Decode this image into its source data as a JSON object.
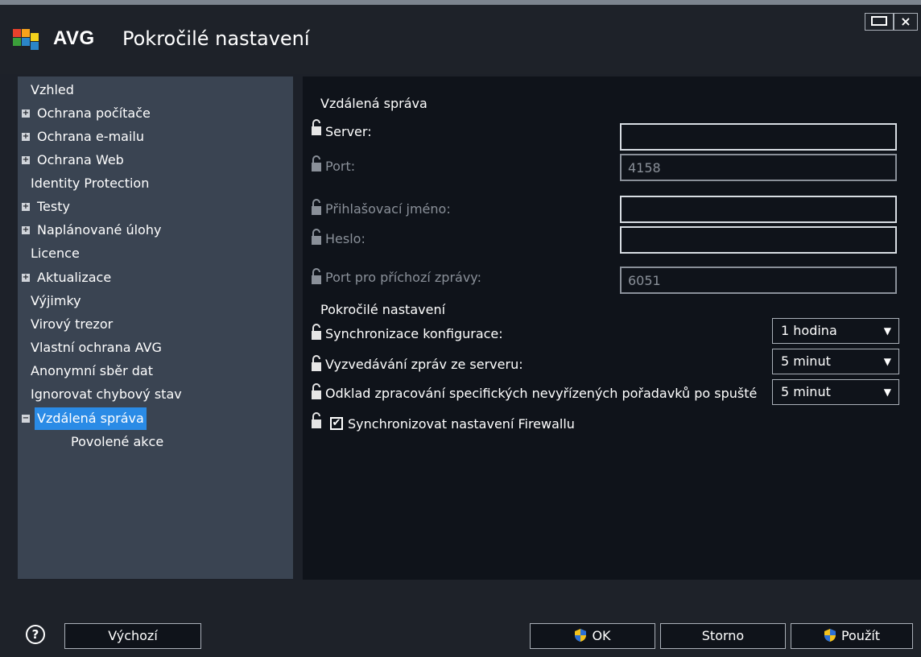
{
  "window": {
    "brand": "AVG",
    "title": "Pokročilé nastavení"
  },
  "sidebar": {
    "items": [
      {
        "label": "Vzhled",
        "expander": ""
      },
      {
        "label": "Ochrana počítače",
        "expander": "+"
      },
      {
        "label": "Ochrana e-mailu",
        "expander": "+"
      },
      {
        "label": "Ochrana Web",
        "expander": "+"
      },
      {
        "label": "Identity Protection",
        "expander": ""
      },
      {
        "label": "Testy",
        "expander": "+"
      },
      {
        "label": "Naplánované úlohy",
        "expander": "+"
      },
      {
        "label": "Licence",
        "expander": ""
      },
      {
        "label": "Aktualizace",
        "expander": "+"
      },
      {
        "label": "Výjimky",
        "expander": ""
      },
      {
        "label": "Virový trezor",
        "expander": ""
      },
      {
        "label": "Vlastní ochrana AVG",
        "expander": ""
      },
      {
        "label": "Anonymní sběr dat",
        "expander": ""
      },
      {
        "label": "Ignorovat chybový stav",
        "expander": ""
      },
      {
        "label": "Vzdálená správa",
        "expander": "−",
        "selected": true
      },
      {
        "label": "Povolené akce",
        "expander": ""
      }
    ]
  },
  "main": {
    "remote_section_title": "Vzdálená správa",
    "server_label": "Server:",
    "server_value": "",
    "port_label": "Port:",
    "port_value": "4158",
    "login_label": "Přihlašovací jméno:",
    "login_value": "",
    "password_label": "Heslo:",
    "password_value": "",
    "incoming_port_label": "Port pro příchozí zprávy:",
    "incoming_port_value": "6051",
    "advanced_section_title": "Pokročilé nastavení",
    "sync_config_label": "Synchronizace konfigurace:",
    "sync_config_value": "1 hodina",
    "fetch_messages_label": "Vyzvedávání zpráv ze serveru:",
    "fetch_messages_value": "5 minut",
    "delay_label": "Odklad zpracování specifických nevyřízených pořadavků po spušté",
    "delay_value": "5 minut",
    "firewall_sync_label": "Synchronizovat nastavení Firewallu",
    "firewall_sync_checked": true,
    "checkmark": "✔",
    "dropdown_arrow": "▼"
  },
  "footer": {
    "help_symbol": "?",
    "default_label": "Výchozí",
    "ok_label": "OK",
    "cancel_label": "Storno",
    "apply_label": "Použít"
  },
  "colors": {
    "selection": "#2a8be6",
    "sidebar_bg": "#3a4452",
    "main_bg": "#0f131a",
    "disabled_text": "#8a9099"
  },
  "icons": [
    "avg-logo-icon",
    "maximize-icon",
    "close-icon",
    "expand-icon",
    "collapse-icon",
    "lock-icon",
    "dropdown-arrow-icon",
    "checkbox-icon",
    "help-icon",
    "shield-icon"
  ]
}
